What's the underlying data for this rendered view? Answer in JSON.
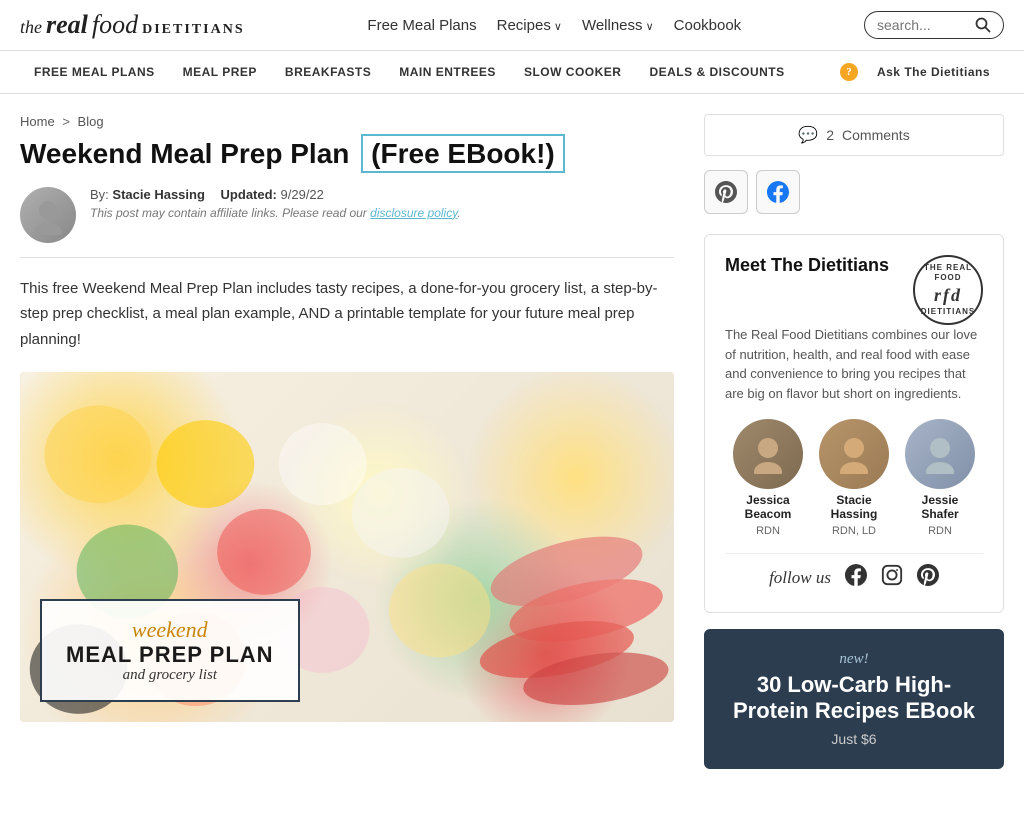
{
  "brand": {
    "the": "the",
    "real": "real",
    "food": "food",
    "dietitians": "DIETITIANS"
  },
  "topnav": {
    "links": [
      {
        "label": "Free Meal Plans",
        "hasArrow": false
      },
      {
        "label": "Recipes",
        "hasArrow": true
      },
      {
        "label": "Wellness",
        "hasArrow": true
      },
      {
        "label": "Cookbook",
        "hasArrow": false
      }
    ],
    "search_placeholder": "search..."
  },
  "secondarynav": {
    "links": [
      "FREE MEAL PLANS",
      "MEAL PREP",
      "BREAKFASTS",
      "MAIN ENTREES",
      "SLOW COOKER",
      "DEALS & DISCOUNTS"
    ],
    "ask_label": "Ask The Dietitians"
  },
  "breadcrumb": {
    "home": "Home",
    "separator": ">",
    "blog": "Blog"
  },
  "post": {
    "title_main": "Weekend Meal Prep Plan",
    "title_highlight": "(Free EBook!)",
    "author_by": "By:",
    "author_name": "Stacie Hassing",
    "updated_label": "Updated:",
    "updated_date": "9/29/22",
    "affiliate_text": "This post may contain affiliate links. Please read our",
    "affiliate_link": "disclosure policy",
    "intro": "This free Weekend Meal Prep Plan includes tasty recipes, a done-for-you grocery list, a step-by-step prep checklist, a meal plan example, AND a printable template for your future meal prep planning!",
    "hero_card": {
      "weekend": "weekend",
      "title_line1": "MEAL PREP PLAN",
      "subtitle": "and grocery list"
    }
  },
  "comments": {
    "count": "2",
    "label": "Comments"
  },
  "share": {
    "pinterest_label": "𝐏",
    "facebook_label": "f"
  },
  "sidebar": {
    "meet": {
      "title": "Meet The Dietitians",
      "rfd_circle": {
        "top": "THE REAL FOOD",
        "middle": "rfd",
        "bottom": "DIETITIANS"
      },
      "description": "The Real Food Dietitians combines our love of nutrition, health, and real food with ease and convenience to bring you recipes that are big on flavor but short on ingredients.",
      "dietitians": [
        {
          "name": "Jessica\nBeacom",
          "cred": "RDN"
        },
        {
          "name": "Stacie\nHassing",
          "cred": "RDN, LD"
        },
        {
          "name": "Jessie\nShafer",
          "cred": "RDN"
        }
      ],
      "follow_label": "follow us"
    },
    "ebook": {
      "new_label": "new!",
      "title": "30 Low-Carb High-Protein Recipes EBook",
      "price": "Just $6"
    }
  }
}
